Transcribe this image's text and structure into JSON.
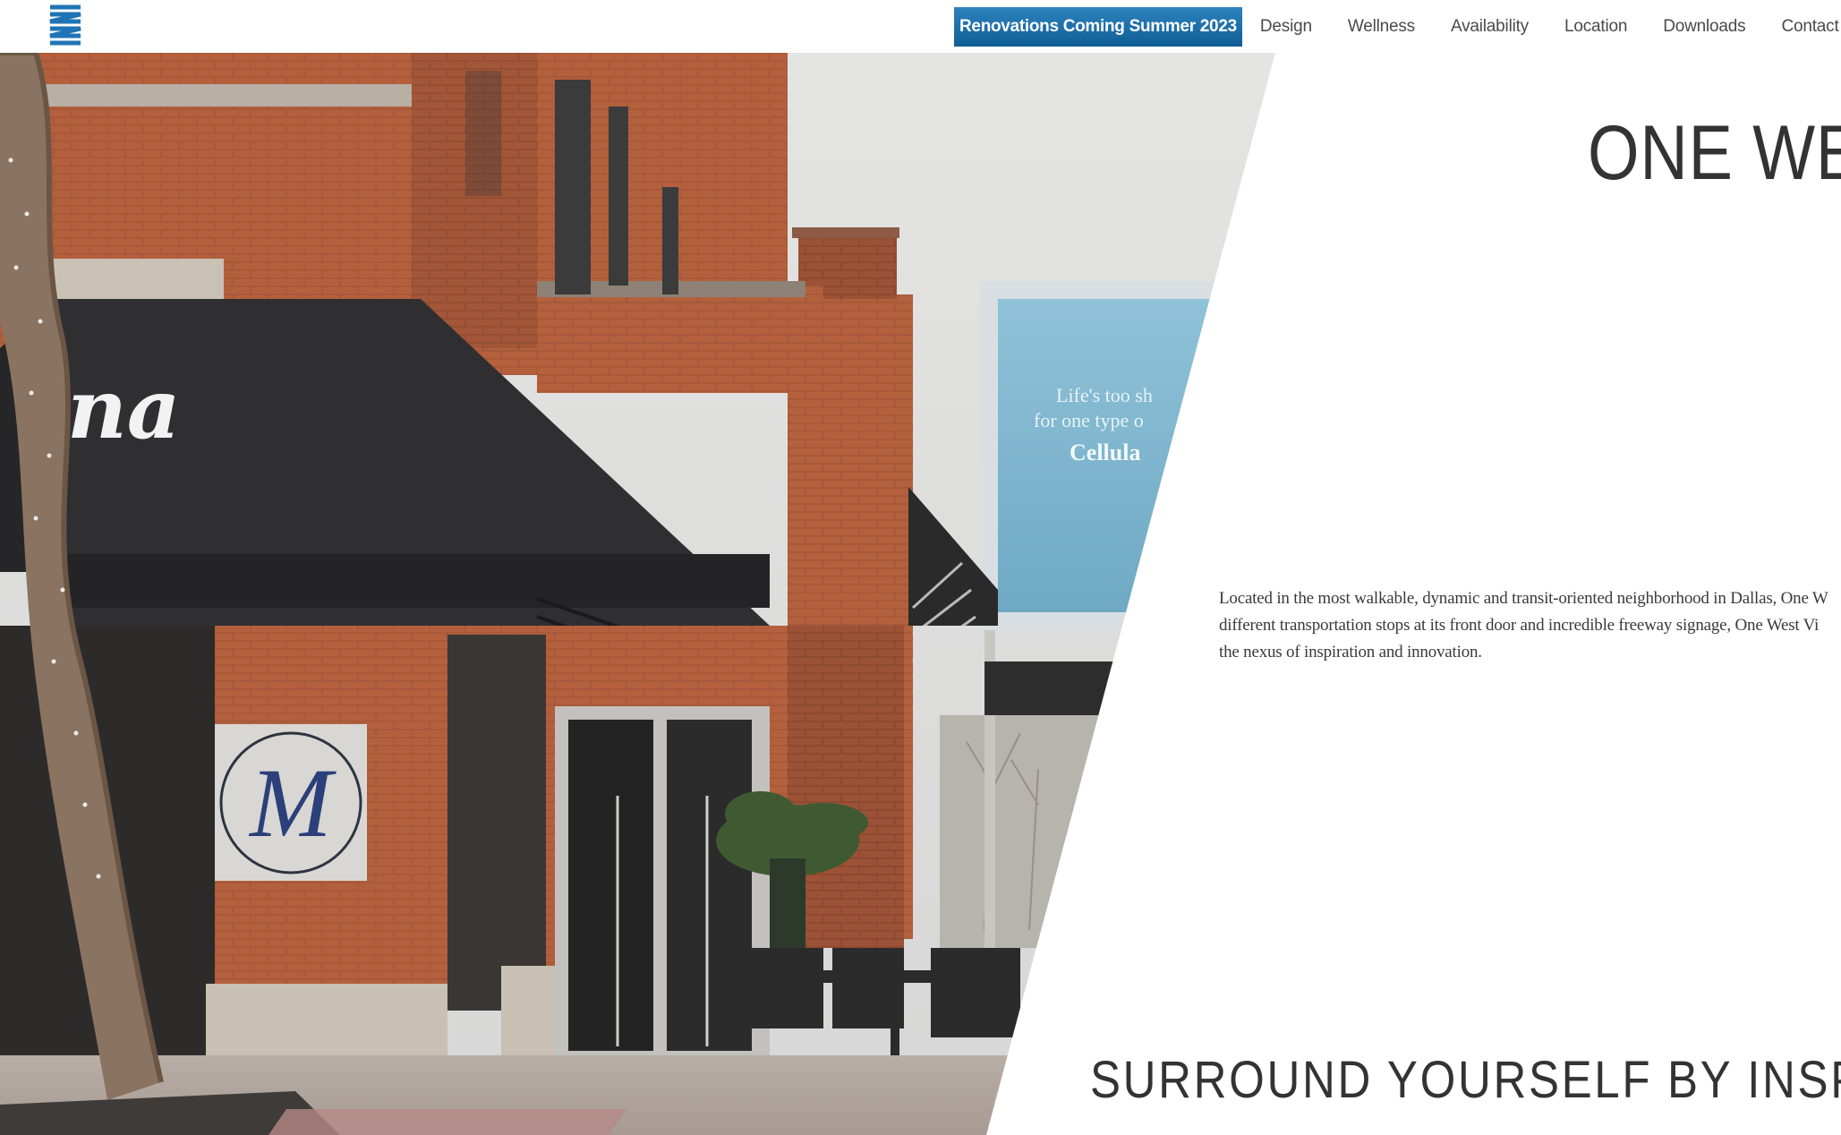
{
  "header": {
    "logo_alt": "OW",
    "cta_label": "Renovations Coming Summer 2023",
    "nav": [
      {
        "label": "Design"
      },
      {
        "label": "Wellness"
      },
      {
        "label": "Availability"
      },
      {
        "label": "Location"
      },
      {
        "label": "Downloads"
      },
      {
        "label": "Contact"
      }
    ]
  },
  "hero": {
    "title": "ONE WES",
    "description_lines": [
      "Located in the most walkable, dynamic and transit-oriented neighborhood in Dallas, One W",
      "different transportation stops at its front door and incredible freeway signage, One West Vi",
      "the nexus of inspiration and innovation."
    ],
    "photo": {
      "awning_script": "ina",
      "sign_letter": "M",
      "billboard_text": [
        "Life's too sh",
        "for one type o",
        "Cellula"
      ]
    }
  },
  "section": {
    "heading": "SURROUND YOURSELF BY INSPI"
  },
  "colors": {
    "cta_bg": "#1c6ea9",
    "logo_blue": "#1f74b6",
    "text_dark": "#333333",
    "brick": "#b25f3c"
  }
}
